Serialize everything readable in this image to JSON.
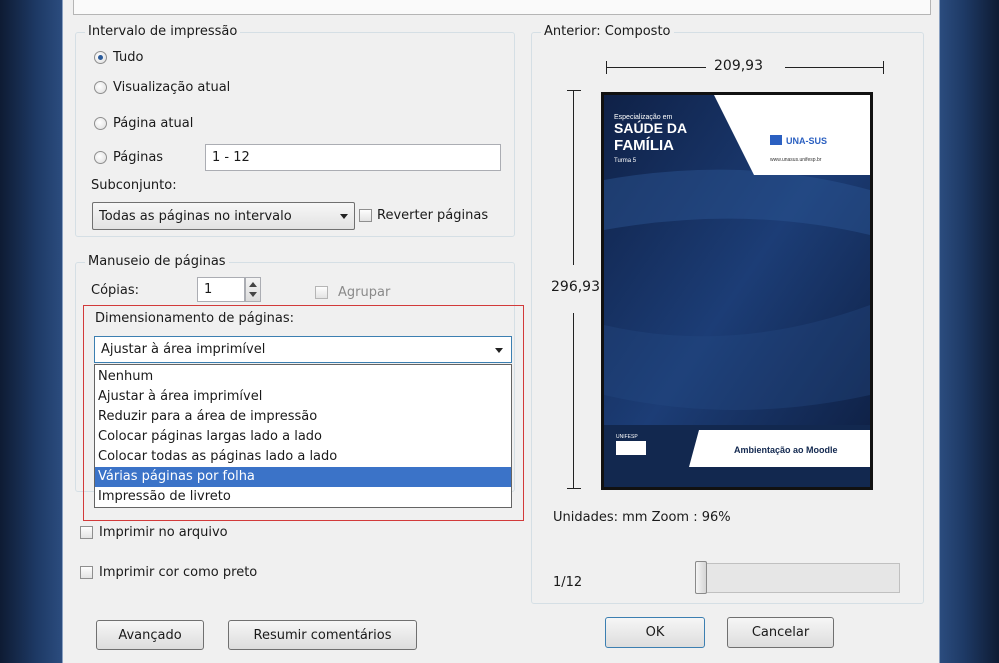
{
  "print_range": {
    "title": "Intervalo de impressão",
    "options": [
      {
        "label": "Tudo",
        "checked": true
      },
      {
        "label": "Visualização atual",
        "checked": false
      },
      {
        "label": "Página atual",
        "checked": false
      },
      {
        "label": "Páginas",
        "checked": false
      }
    ],
    "pages_value": "1 - 12",
    "subset_label": "Subconjunto:",
    "subset_value": "Todas as páginas no intervalo",
    "reverse_label": "Reverter páginas"
  },
  "page_handling": {
    "title": "Manuseio de páginas",
    "copies_label": "Cópias:",
    "copies_value": "1",
    "collate_label": "Agrupar",
    "scaling_label": "Dimensionamento de páginas:",
    "scaling_value": "Ajustar à área imprimível",
    "scaling_options": [
      "Nenhum",
      "Ajustar à área imprimível",
      "Reduzir para a área de impressão",
      "Colocar páginas largas lado a lado",
      "Colocar todas as páginas lado a lado",
      "Várias páginas por folha",
      "Impressão de livreto"
    ],
    "scaling_highlighted_index": 5
  },
  "options": {
    "print_to_file": "Imprimir no arquivo",
    "print_black": "Imprimir cor como preto"
  },
  "preview": {
    "title": "Anterior: Composto",
    "width_label": "209,93",
    "height_label": "296,93",
    "units_zoom": "Unidades: mm Zoom :  96%",
    "page_indicator": "1/12",
    "slider_position_fraction": 0.0,
    "cover": {
      "small_caption": "Especialização em",
      "title_line1": "SAÚDE DA",
      "title_line2": "FAMÍLIA",
      "sub_caption": "Turma 5",
      "logo_text": "UNA-SUS",
      "url_text": "www.unasus.unifesp.br",
      "footer_logo": "UNIFESP",
      "footer_text": "Ambientação ao Moodle",
      "navy": "#12284f",
      "accent": "#1d3f7a"
    }
  },
  "buttons": {
    "advanced": "Avançado",
    "summarize": "Resumir comentários",
    "ok": "OK",
    "cancel": "Cancelar"
  },
  "colors": {
    "highlight_border": "#d23a3a",
    "selection": "#3b73c8"
  }
}
